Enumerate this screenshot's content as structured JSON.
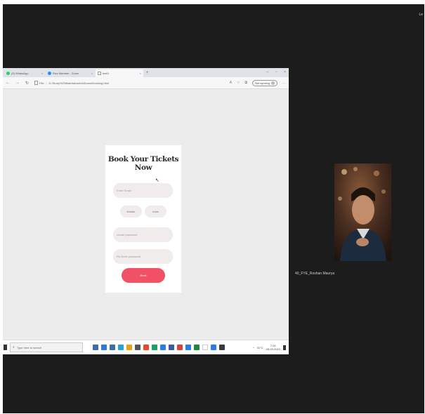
{
  "window_indicator": "Le",
  "browser": {
    "tabs": [
      {
        "label": "(5) WhatsApp",
        "icon_color": "#25d366",
        "active": false
      },
      {
        "label": "Rizz Member - Zoom",
        "icon_color": "#2d8cff",
        "active": false
      },
      {
        "label": "test3",
        "icon_color": "#ffffff",
        "active": true
      }
    ],
    "new_tab_label": "+",
    "window_controls": [
      "–",
      "▫",
      "×"
    ],
    "url_prefix": "File",
    "url": "D:/Study%20Material/webd/Alumni/booking.html",
    "sync_label": "Not syncing"
  },
  "booking": {
    "title": "Book Your Tickets Now",
    "email_placeholder": "Enter Email",
    "gender_female": "female",
    "gender_male": "male",
    "password_placeholder": "create password",
    "repassword_placeholder": "Re-Enter password",
    "book_label": "Book",
    "accent_color": "#f25065"
  },
  "taskbar": {
    "search_placeholder": "Type here to search",
    "app_colors": [
      "#3a6ea5",
      "#2d7bd6",
      "#3a6ea5",
      "#2aa0d8",
      "#e6a21e",
      "#555555",
      "#e44b2b",
      "#1aa260",
      "#2b7de9",
      "#3c5aa8",
      "#d64242",
      "#2b7de9",
      "#1e8a3b",
      "#ffffff",
      "#2b7de9",
      "#3a3a3a"
    ],
    "weather": "31°C",
    "time": "7:24",
    "date": "28-03-2022"
  },
  "participant": {
    "name": "40_FYE_Roshan Maurya"
  }
}
